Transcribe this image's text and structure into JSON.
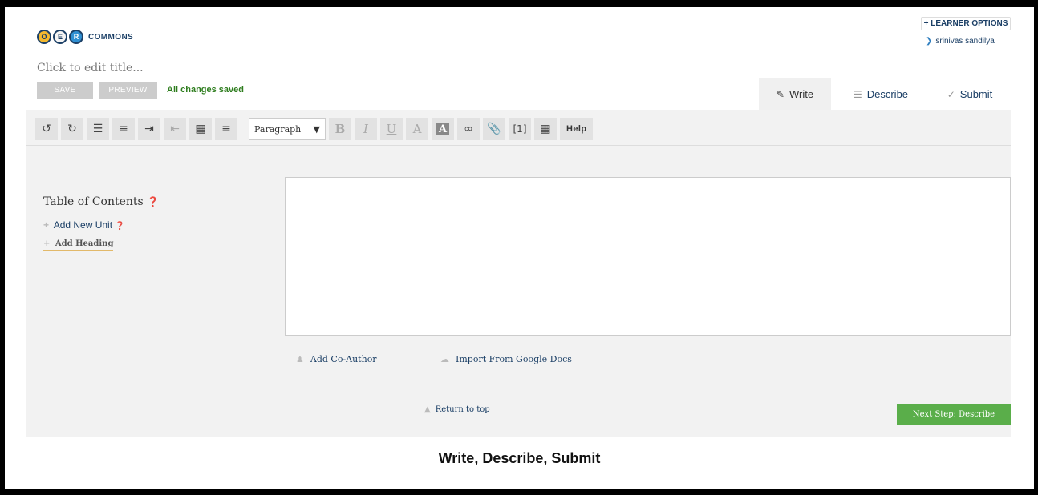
{
  "header": {
    "logo_letters": [
      "O",
      "E",
      "R"
    ],
    "logo_text": "COMMONS",
    "learner_options": "+ LEARNER OPTIONS",
    "user_name": "srinivas sandilya"
  },
  "editor_meta": {
    "title_placeholder": "Click to edit title...",
    "save_label": "SAVE",
    "preview_label": "PREVIEW",
    "status": "All changes saved"
  },
  "tabs": [
    {
      "label": "Write",
      "icon": "pencil-icon"
    },
    {
      "label": "Describe",
      "icon": "list-icon"
    },
    {
      "label": "Submit",
      "icon": "check-icon"
    }
  ],
  "toolbar": {
    "undo": "↺",
    "redo": "↻",
    "bold": "B",
    "italic": "I",
    "underline": "U",
    "font_color": "A",
    "bg_color": "A",
    "footnote": "[1]",
    "paragraph_select": "Paragraph",
    "help": "Help"
  },
  "sidebar": {
    "toc_title": "Table of Contents",
    "add_unit": "Add New Unit",
    "add_heading": "Add Heading"
  },
  "actions": {
    "add_coauthor": "Add Co-Author",
    "import_gdocs": "Import From Google Docs",
    "return_top": "Return to top",
    "next_step": "Next Step: Describe"
  },
  "caption": "Write, Describe, Submit",
  "colors": {
    "brand_navy": "#1b3f66",
    "saved_green": "#2e7d1e",
    "next_button": "#5aae4a"
  }
}
